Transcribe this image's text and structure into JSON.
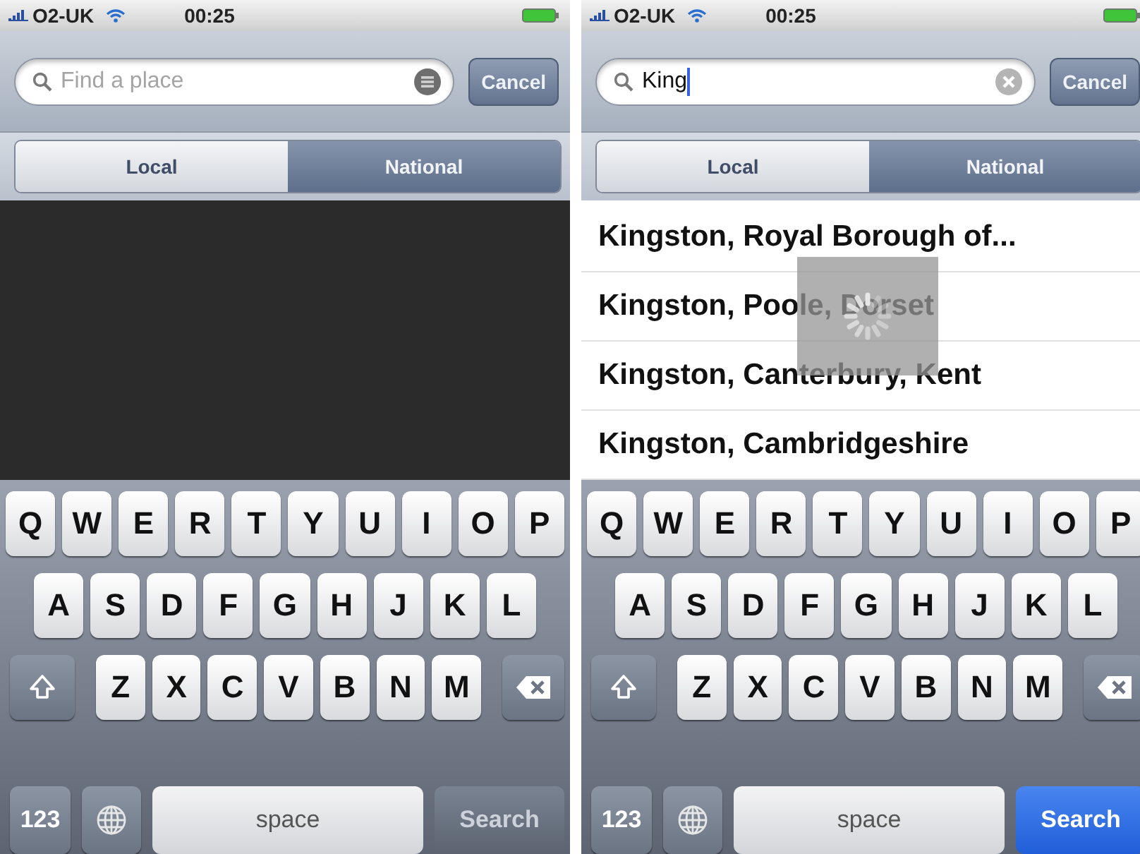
{
  "screens": [
    {
      "status_bar": {
        "carrier": "O2-UK",
        "time": "00:25"
      },
      "search": {
        "placeholder": "Find a place",
        "focused": false,
        "clearable": false
      },
      "cancel": "Cancel",
      "segments": [
        {
          "label": "Local",
          "selected": false
        },
        {
          "label": "National",
          "selected": true
        }
      ],
      "dimmed": true,
      "loading": false,
      "keyboard": {
        "rows": [
          [
            "Q",
            "W",
            "E",
            "R",
            "T",
            "Y",
            "U",
            "I",
            "O",
            "P"
          ],
          [
            "A",
            "S",
            "D",
            "F",
            "G",
            "H",
            "J",
            "K",
            "L"
          ],
          [
            "Z",
            "X",
            "C",
            "V",
            "B",
            "N",
            "M"
          ]
        ],
        "numbers": "123",
        "space": "space",
        "action": "Search",
        "action_enabled": false
      }
    },
    {
      "status_bar": {
        "carrier": "O2-UK",
        "time": "00:25"
      },
      "search": {
        "value": "King",
        "focused": true,
        "clearable": true
      },
      "cancel": "Cancel",
      "segments": [
        {
          "label": "Local",
          "selected": false
        },
        {
          "label": "National",
          "selected": true
        }
      ],
      "dimmed": false,
      "loading": true,
      "results": [
        "Kingston, Royal Borough of...",
        "Kingston, Poole, Dorset",
        "Kingston, Canterbury, Kent",
        "Kingston, Cambridgeshire"
      ],
      "keyboard": {
        "rows": [
          [
            "Q",
            "W",
            "E",
            "R",
            "T",
            "Y",
            "U",
            "I",
            "O",
            "P"
          ],
          [
            "A",
            "S",
            "D",
            "F",
            "G",
            "H",
            "J",
            "K",
            "L"
          ],
          [
            "Z",
            "X",
            "C",
            "V",
            "B",
            "N",
            "M"
          ]
        ],
        "numbers": "123",
        "space": "space",
        "action": "Search",
        "action_enabled": true
      }
    }
  ]
}
